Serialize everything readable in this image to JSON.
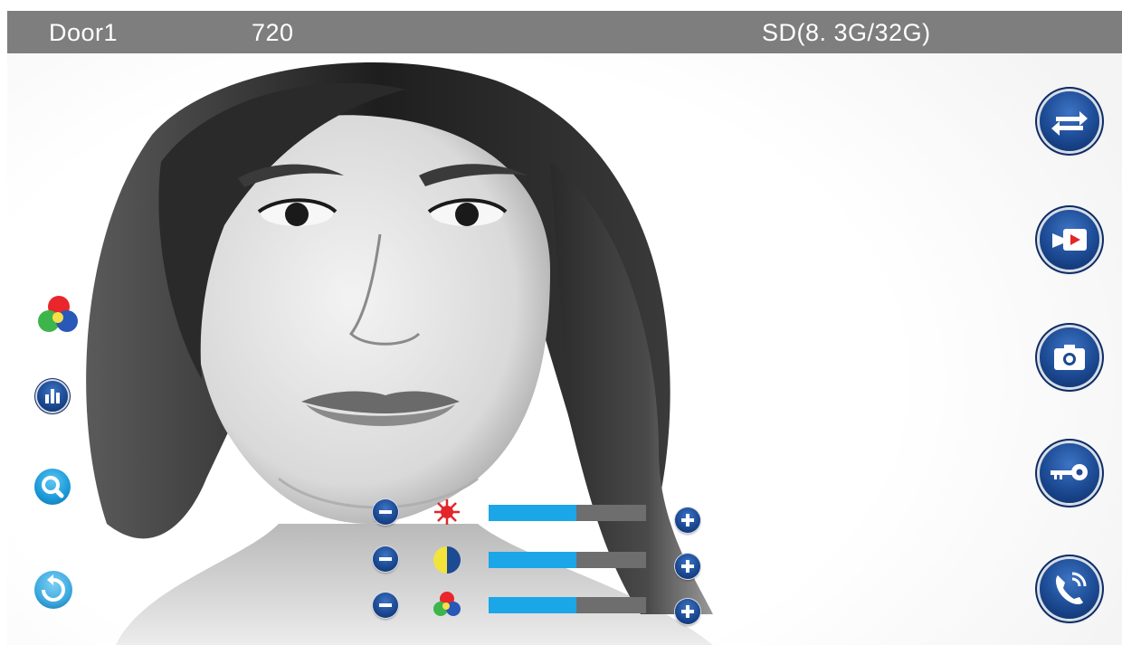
{
  "status_bar": {
    "door_label": "Door1",
    "resolution": "720",
    "storage": "SD(8. 3G/32G)"
  },
  "camera_feed": {
    "icon": "person-portrait-image"
  },
  "left_toolbar": [
    {
      "name": "color-adjust",
      "icon": "color-circles-icon"
    },
    {
      "name": "equalizer",
      "icon": "equalizer-icon"
    },
    {
      "name": "zoom",
      "icon": "magnifier-icon"
    },
    {
      "name": "back",
      "icon": "return-arrow-icon"
    }
  ],
  "right_toolbar": [
    {
      "name": "switch-camera",
      "icon": "switch-arrows-icon"
    },
    {
      "name": "record-video",
      "icon": "video-camera-icon"
    },
    {
      "name": "snapshot",
      "icon": "photo-camera-icon"
    },
    {
      "name": "unlock",
      "icon": "key-icon"
    },
    {
      "name": "call",
      "icon": "phone-call-icon"
    }
  ],
  "sliders": [
    {
      "name": "brightness",
      "icon": "brightness-icon",
      "value": 0.56
    },
    {
      "name": "contrast",
      "icon": "contrast-icon",
      "value": 0.56
    },
    {
      "name": "color-saturation",
      "icon": "color-circles-icon",
      "value": 0.56
    }
  ],
  "colors": {
    "status_bar_bg": "#7e7e7e",
    "button_blue": "#1c4a93",
    "slider_fill": "#1ba6e8",
    "slider_track": "#6e6e6e"
  }
}
